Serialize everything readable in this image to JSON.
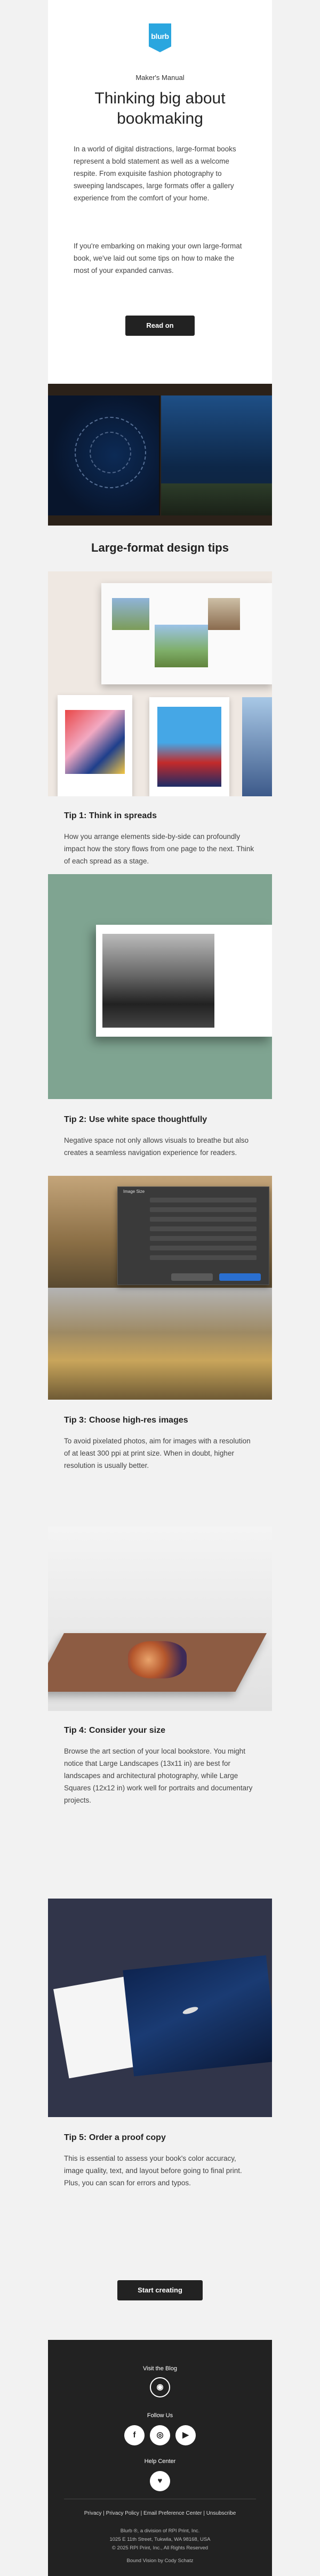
{
  "brand": {
    "logo_text": "blurb",
    "accent": "#2aa6df"
  },
  "hero": {
    "kicker": "Maker's Manual",
    "title": "Thinking big about bookmaking",
    "p1": "In a world of digital distractions, large-format books represent a bold statement as well as a welcome respite. From exquisite fashion photography to sweeping landscapes, large formats offer a gallery experience from the comfort of your home.",
    "p2": "If you're embarking on making your own large-format book, we've laid out some tips on how to make the most of your expanded canvas.",
    "cta": "Read on"
  },
  "section_title": "Large-format design tips",
  "tips": [
    {
      "title": "Tip 1: Think in spreads",
      "body": "How you arrange elements side-by-side can profoundly impact how the story flows from one page to the next. Think of each spread as a stage."
    },
    {
      "title": "Tip 2: Use white space thoughtfully",
      "body": "Negative space not only allows visuals to breathe but also creates a seamless navigation experience for readers."
    },
    {
      "title": "Tip 3: Choose high-res images",
      "body": "To avoid pixelated photos, aim for images with a resolution of at least 300 ppi at print size. When in doubt, higher resolution is usually better."
    },
    {
      "title": "Tip 4: Consider your size",
      "body": "Browse the art section of your local bookstore. You might notice that Large Landscapes (13x11 in) are best for landscapes and architectural photography, while Large Squares (12x12 in) work well for portraits and documentary projects."
    },
    {
      "title": "Tip 5: Order a proof copy",
      "body": "This is essential to assess your book's color accuracy, image quality, text, and layout before going to final print. Plus, you can scan for errors and typos."
    }
  ],
  "dialog_title": "Image Size",
  "cta2": "Start creating",
  "footer": {
    "visit_blog": "Visit the Blog",
    "follow_us": "Follow Us",
    "help_center": "Help Center",
    "links": "Privacy | Privacy Policy | Email Preference Center | Unsubscribe",
    "address1": "Blurb ®, a division of RPI Print, Inc.",
    "address2": "1025 E 11th Street, Tukwila, WA 98168, USA",
    "copyright": "© 2025 RPI Print, Inc., All Rights Reserved",
    "credit": "Bound Vision by Cody Schatz"
  }
}
